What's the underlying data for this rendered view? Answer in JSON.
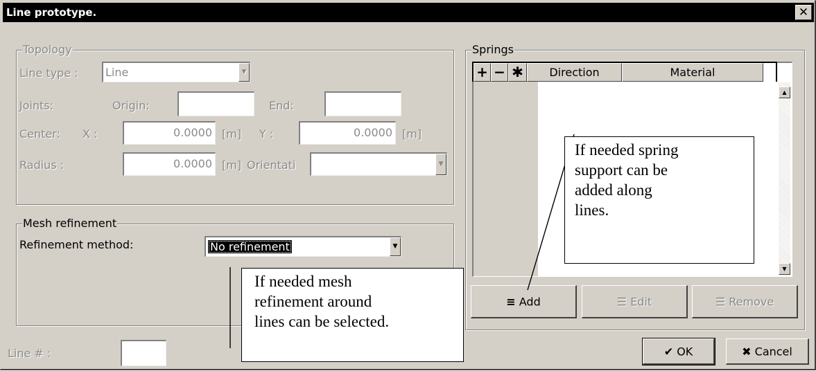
{
  "window": {
    "title": "Line prototype.",
    "close_glyph": "✕"
  },
  "topology": {
    "label": "Topology",
    "line_type_label": "Line type :",
    "line_type_value": "Line",
    "joints_label": "Joints:",
    "origin_label": "Origin:",
    "origin_value": "",
    "end_label": "End:",
    "end_value": "",
    "center_label": "Center:",
    "x_label": "X :",
    "x_value": "0.0000",
    "x_unit": "[m]",
    "y_label": "Y :",
    "y_value": "0.0000",
    "y_unit": "[m]",
    "radius_label": "Radius :",
    "radius_value": "0.0000",
    "radius_unit": "[m]",
    "orientation_label": "Orientati",
    "orientation_value": ""
  },
  "mesh": {
    "label": "Mesh refinement",
    "method_label": "Refinement method:",
    "method_value": "No refinement"
  },
  "line_number": {
    "label": "Line # :",
    "value": ""
  },
  "springs": {
    "label": "Springs",
    "tools": {
      "add": "+",
      "remove": "−",
      "star": "✱"
    },
    "columns": [
      "Direction",
      "Material"
    ],
    "rows": []
  },
  "buttons": {
    "add": "Add",
    "edit": "Edit",
    "remove": "Remove",
    "ok": "OK",
    "cancel": "Cancel"
  },
  "annotations": {
    "springs_note": [
      "If needed spring",
      "support can be",
      "added along",
      "lines."
    ],
    "mesh_note": [
      "If needed mesh",
      "refinement around",
      "lines can be selected."
    ]
  },
  "icons": {
    "ok": "check-icon",
    "cancel": "x-icon",
    "add": "list-add-icon",
    "edit": "list-edit-icon",
    "remove": "list-remove-icon",
    "dropdown": "chevron-down-icon"
  },
  "colors": {
    "face": "#d4d0c8",
    "disabled_text": "#8a8a8a",
    "titlebar": "#000000"
  }
}
